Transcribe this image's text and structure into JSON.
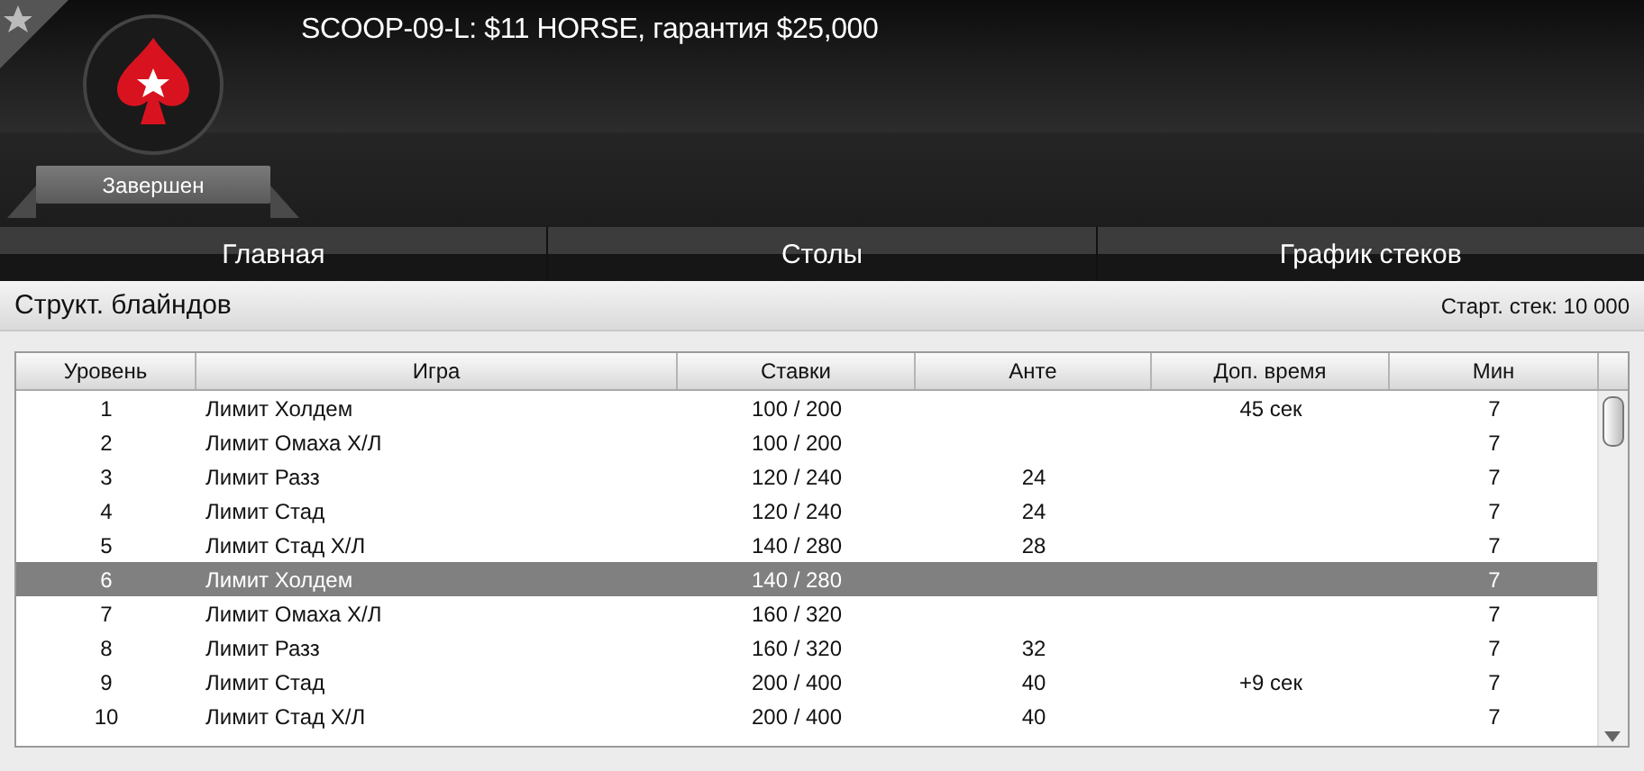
{
  "header": {
    "title": "SCOOP-09-L: $11 HORSE, гарантия $25,000",
    "status": "Завершен",
    "favorite": false
  },
  "tabs": [
    {
      "label": "Главная",
      "selected": false
    },
    {
      "label": "Столы",
      "selected": false
    },
    {
      "label": "График стеков",
      "selected": false
    }
  ],
  "section": {
    "title": "Структ. блайндов",
    "starting_stack": "Старт. стек: 10 000"
  },
  "table": {
    "columns": [
      "Уровень",
      "Игра",
      "Ставки",
      "Анте",
      "Доп. время",
      "Мин"
    ],
    "rows": [
      {
        "cells": [
          "1",
          "Лимит Холдем",
          "100 / 200",
          "",
          "45 сек",
          "7"
        ],
        "selected": false
      },
      {
        "cells": [
          "2",
          "Лимит Омаха Х/Л",
          "100 / 200",
          "",
          "",
          "7"
        ],
        "selected": false
      },
      {
        "cells": [
          "3",
          "Лимит Разз",
          "120 / 240",
          "24",
          "",
          "7"
        ],
        "selected": false
      },
      {
        "cells": [
          "4",
          "Лимит Стад",
          "120 / 240",
          "24",
          "",
          "7"
        ],
        "selected": false
      },
      {
        "cells": [
          "5",
          "Лимит Стад Х/Л",
          "140 / 280",
          "28",
          "",
          "7"
        ],
        "selected": false
      },
      {
        "cells": [
          "6",
          "Лимит Холдем",
          "140 / 280",
          "",
          "",
          "7"
        ],
        "selected": true
      },
      {
        "cells": [
          "7",
          "Лимит Омаха Х/Л",
          "160 / 320",
          "",
          "",
          "7"
        ],
        "selected": false
      },
      {
        "cells": [
          "8",
          "Лимит Разз",
          "160 / 320",
          "32",
          "",
          "7"
        ],
        "selected": false
      },
      {
        "cells": [
          "9",
          "Лимит Стад",
          "200 / 400",
          "40",
          "+9 сек",
          "7"
        ],
        "selected": false
      },
      {
        "cells": [
          "10",
          "Лимит Стад Х/Л",
          "200 / 400",
          "40",
          "",
          "7"
        ],
        "selected": false
      }
    ]
  }
}
